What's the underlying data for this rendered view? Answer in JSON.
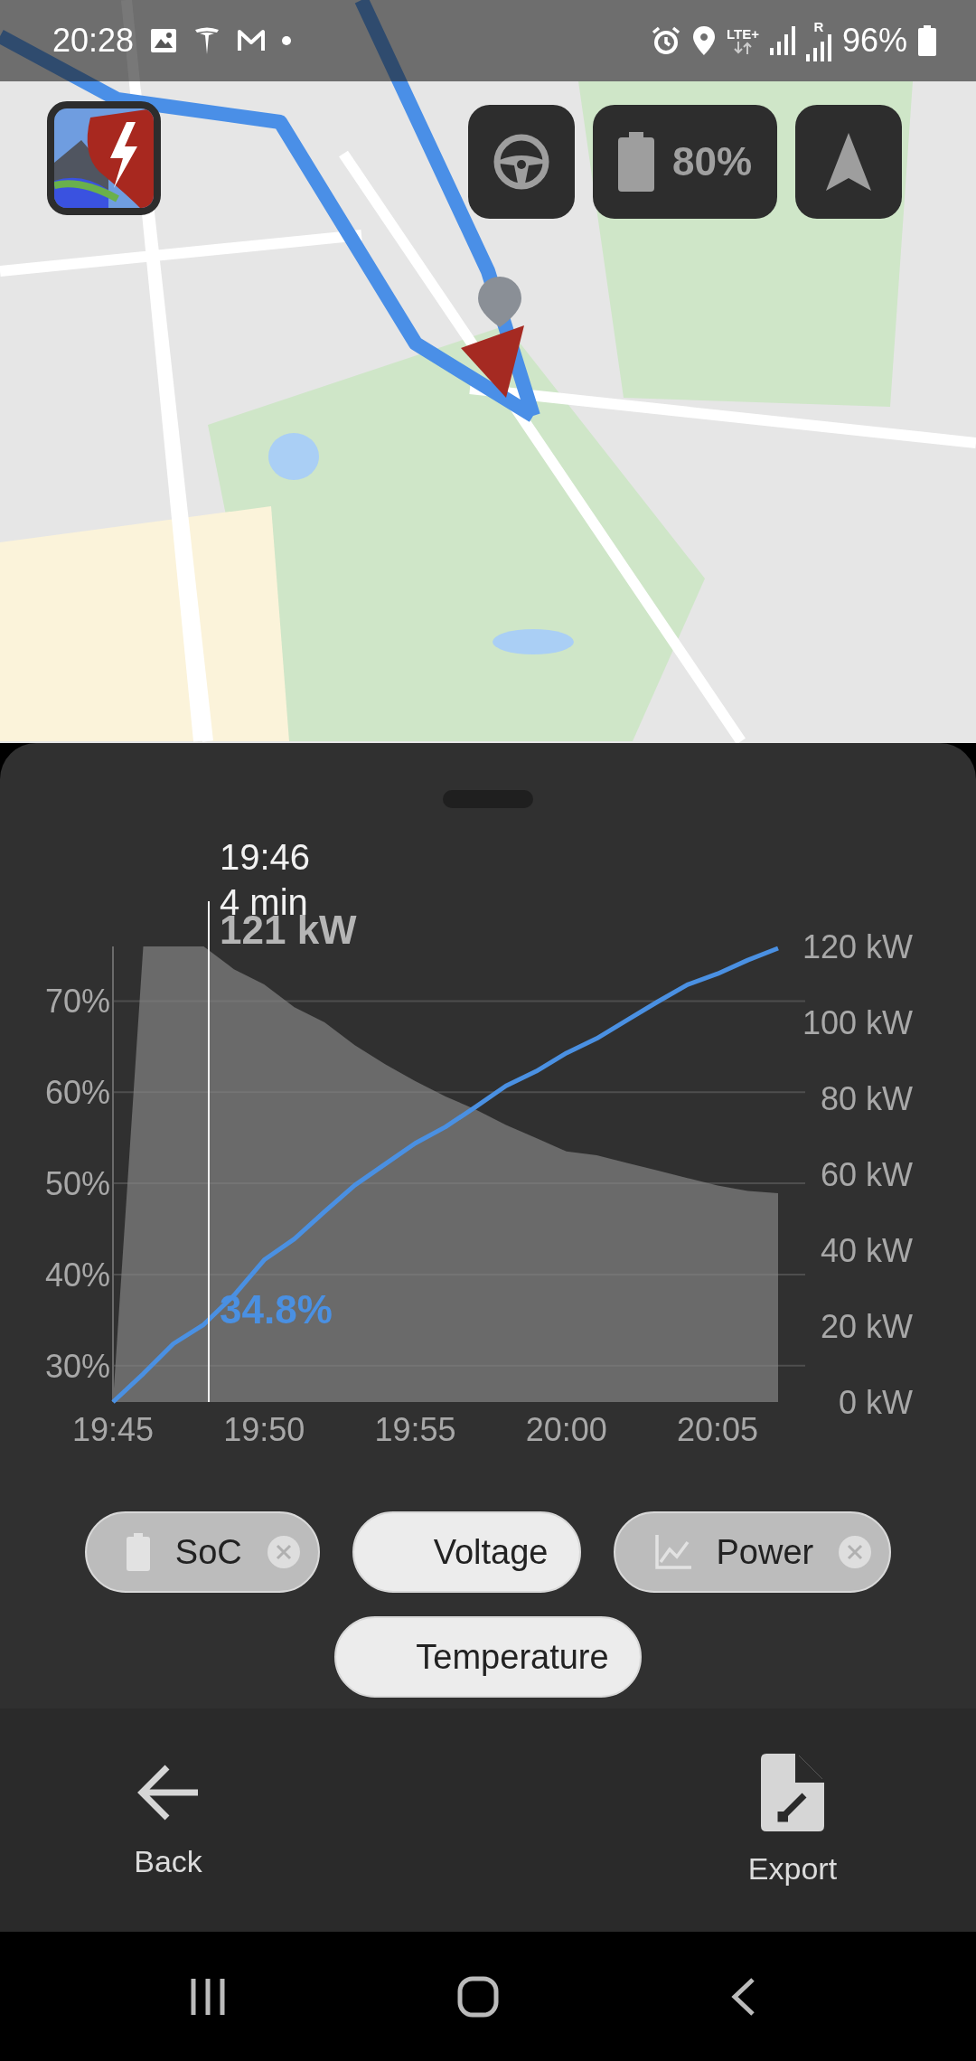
{
  "status_bar": {
    "time": "20:28",
    "network": "LTE+",
    "roaming": "R",
    "battery": "96%"
  },
  "top_controls": {
    "battery_charge": "80%"
  },
  "chart": {
    "cursor": {
      "time": "19:46",
      "duration": "4 min",
      "power": "121 kW",
      "soc": "34.8%"
    },
    "soc_chart": {
      "chart_data": {
        "type": "line",
        "categories": [
          "19:45",
          null,
          null,
          null,
          null,
          "19:50",
          null,
          null,
          null,
          null,
          "19:55",
          null,
          null,
          null,
          null,
          "20:00",
          null,
          null,
          null,
          null,
          "20:05",
          null,
          null
        ],
        "grid": true,
        "ylim": [
          26,
          76
        ],
        "yticks": [
          {
            "value": 30,
            "label": "30%"
          },
          {
            "value": 40,
            "label": "40%"
          },
          {
            "value": 50,
            "label": "50%"
          },
          {
            "value": 60,
            "label": "60%"
          },
          {
            "value": 70,
            "label": "70%"
          }
        ],
        "series": [
          {
            "color": "#4a90e2",
            "values": [
              26,
              29.1,
              32.4,
              34.5,
              37.7,
              41.6,
              43.9,
              46.9,
              49.8,
              52.1,
              54.4,
              56.2,
              58.4,
              60.7,
              62.3,
              64.3,
              65.9,
              67.9,
              69.9,
              71.8,
              73,
              74.5,
              75.8
            ]
          }
        ]
      }
    },
    "power_chart": {
      "chart_data": {
        "type": "area",
        "ylim": [
          0,
          120
        ],
        "yticks": [
          {
            "value": 0,
            "label": "0 kW"
          },
          {
            "value": 20,
            "label": "20 kW"
          },
          {
            "value": 40,
            "label": "40 kW"
          },
          {
            "value": 60,
            "label": "60 kW"
          },
          {
            "value": 80,
            "label": "80 kW"
          },
          {
            "value": 100,
            "label": "100 kW"
          },
          {
            "value": 120,
            "label": "120 kW"
          }
        ],
        "series": [
          {
            "color": "#6a6a6a",
            "values": [
              0,
              120,
              120,
              120,
              114,
              110,
              104,
              100,
              94,
              89,
              84.5,
              80.5,
              77,
              73,
              69.5,
              66,
              65,
              63,
              61,
              59,
              57,
              55.6,
              55
            ]
          }
        ]
      }
    }
  },
  "chips": [
    {
      "label": "SoC",
      "selected": true,
      "kind": "battery"
    },
    {
      "label": "Voltage",
      "selected": false
    },
    {
      "label": "Power",
      "selected": true,
      "kind": "chart"
    },
    {
      "label": "Temperature",
      "selected": false
    }
  ],
  "bottom_bar": {
    "actions": [
      {
        "label": "Back",
        "kind": "back"
      },
      {
        "label": "Export",
        "kind": "export"
      }
    ]
  }
}
